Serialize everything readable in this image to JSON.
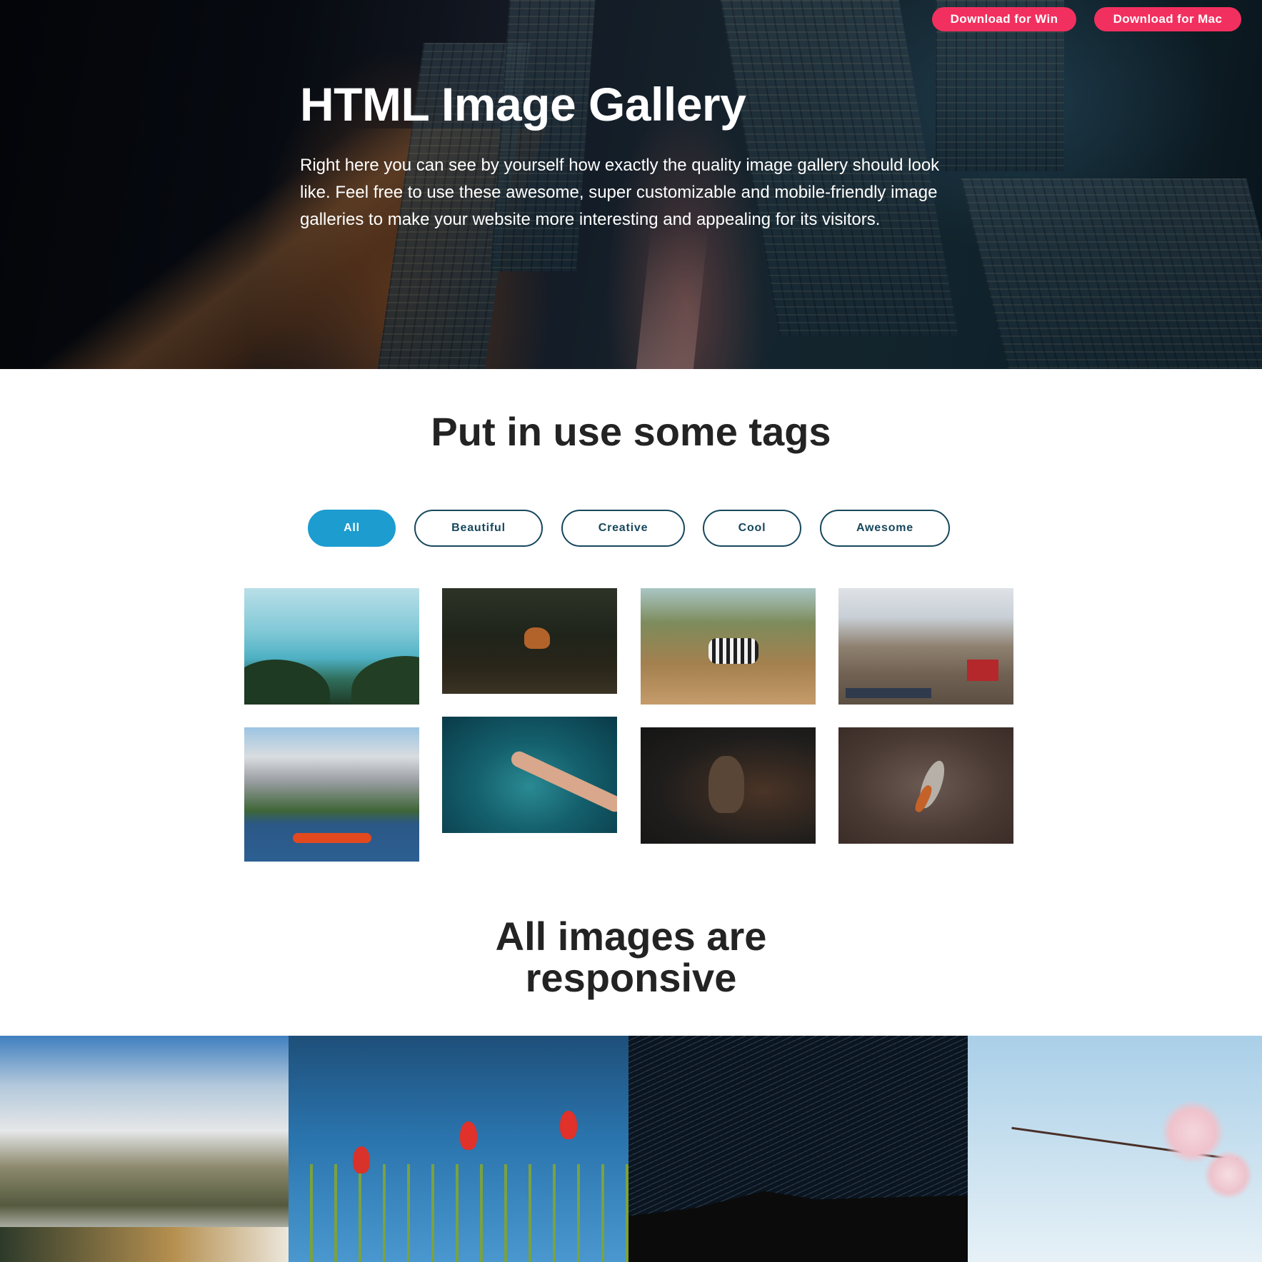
{
  "hero": {
    "title": "HTML Image Gallery",
    "description": "Right here you can see by yourself how exactly the quality image gallery should look like. Feel free to use these awesome, super customizable and mobile-friendly image galleries to make your website more interesting and appealing for its visitors.",
    "buttons": {
      "win": "Download for Win",
      "mac": "Download for Mac"
    }
  },
  "tags_section": {
    "title": "Put in use some tags",
    "tags": [
      "All",
      "Beautiful",
      "Creative",
      "Cool",
      "Awesome"
    ],
    "active_tag": "All"
  },
  "responsive_section": {
    "title_line1": "All images are",
    "title_line2": "responsive"
  },
  "colors": {
    "download_button": "#f2305f",
    "active_tag": "#1c9ccf",
    "tag_border": "#17475c",
    "heading_text": "#232323"
  }
}
